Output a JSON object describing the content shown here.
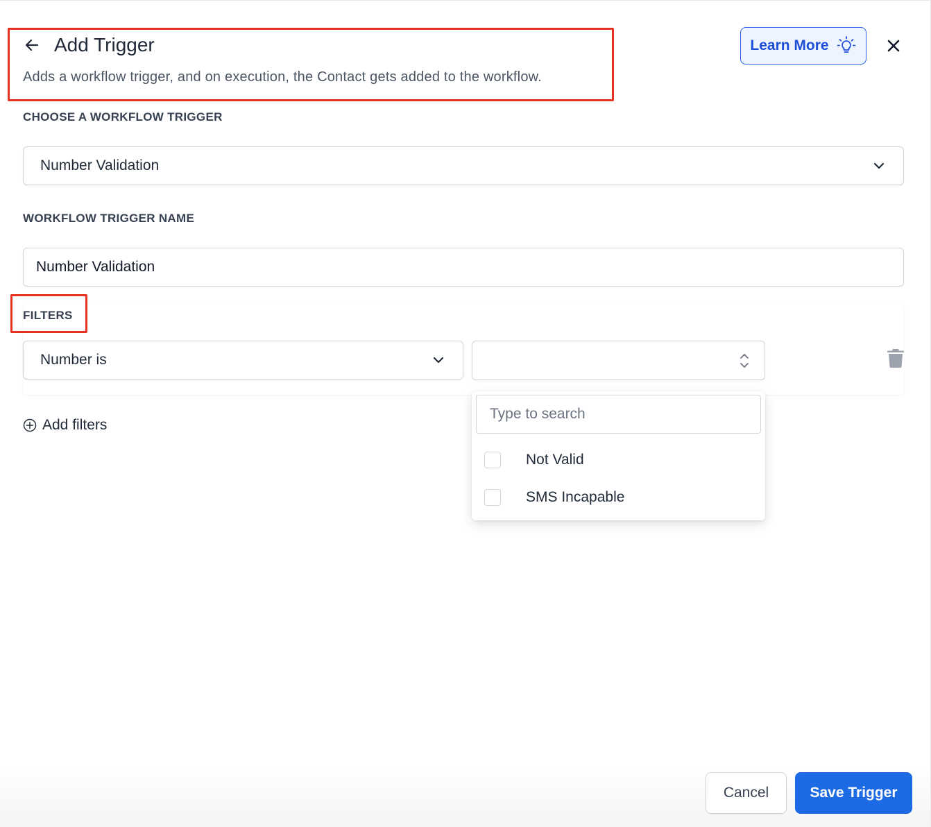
{
  "header": {
    "title": "Add Trigger",
    "subtitle": "Adds a workflow trigger, and on execution, the Contact gets added to the workflow.",
    "learn_more_label": "Learn More"
  },
  "trigger_section": {
    "label": "CHOOSE A WORKFLOW TRIGGER",
    "selected": "Number Validation"
  },
  "name_section": {
    "label": "WORKFLOW TRIGGER NAME",
    "value": "Number Validation"
  },
  "filters": {
    "label": "FILTERS",
    "field_selected": "Number is",
    "value_selected": "",
    "add_label": "Add filters"
  },
  "dropdown": {
    "search_placeholder": "Type to search",
    "options": [
      {
        "label": "Not Valid",
        "checked": false
      },
      {
        "label": "SMS Incapable",
        "checked": false
      }
    ]
  },
  "footer": {
    "cancel_label": "Cancel",
    "save_label": "Save Trigger"
  },
  "colors": {
    "primary": "#1d6ae5",
    "highlight": "#e5311f",
    "learn_more_bg": "#eef4ff"
  },
  "icons": [
    "arrow-left-icon",
    "lightbulb-icon",
    "close-icon",
    "chevron-down-icon",
    "chevron-updown-icon",
    "trash-icon",
    "plus-circle-icon"
  ]
}
